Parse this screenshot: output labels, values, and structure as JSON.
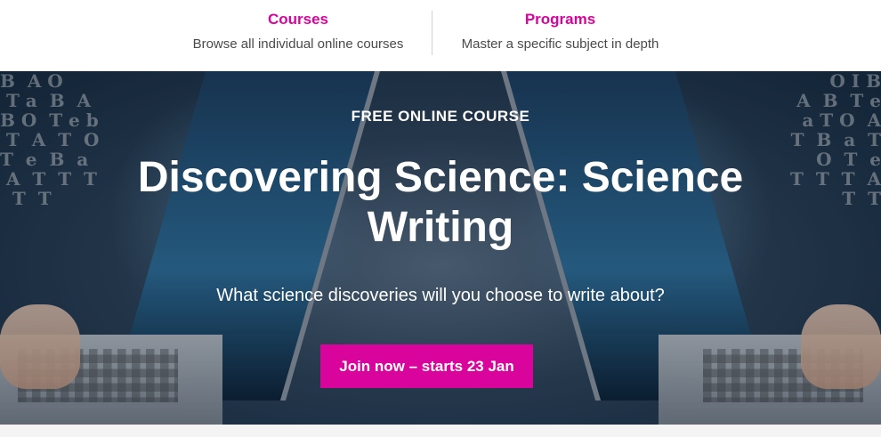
{
  "nav": {
    "items": [
      {
        "title": "Courses",
        "description": "Browse all individual online courses"
      },
      {
        "title": "Programs",
        "description": "Master a specific subject in depth"
      }
    ]
  },
  "hero": {
    "eyebrow": "FREE ONLINE COURSE",
    "headline": "Discovering Science: Science Writing",
    "subtitle": "What science discoveries will you choose to write about?",
    "cta_label": "Join now – starts 23 Jan"
  },
  "colors": {
    "accent": "#d8049b",
    "nav_text": "#4a4a4a",
    "hero_dark": "#13273a"
  }
}
